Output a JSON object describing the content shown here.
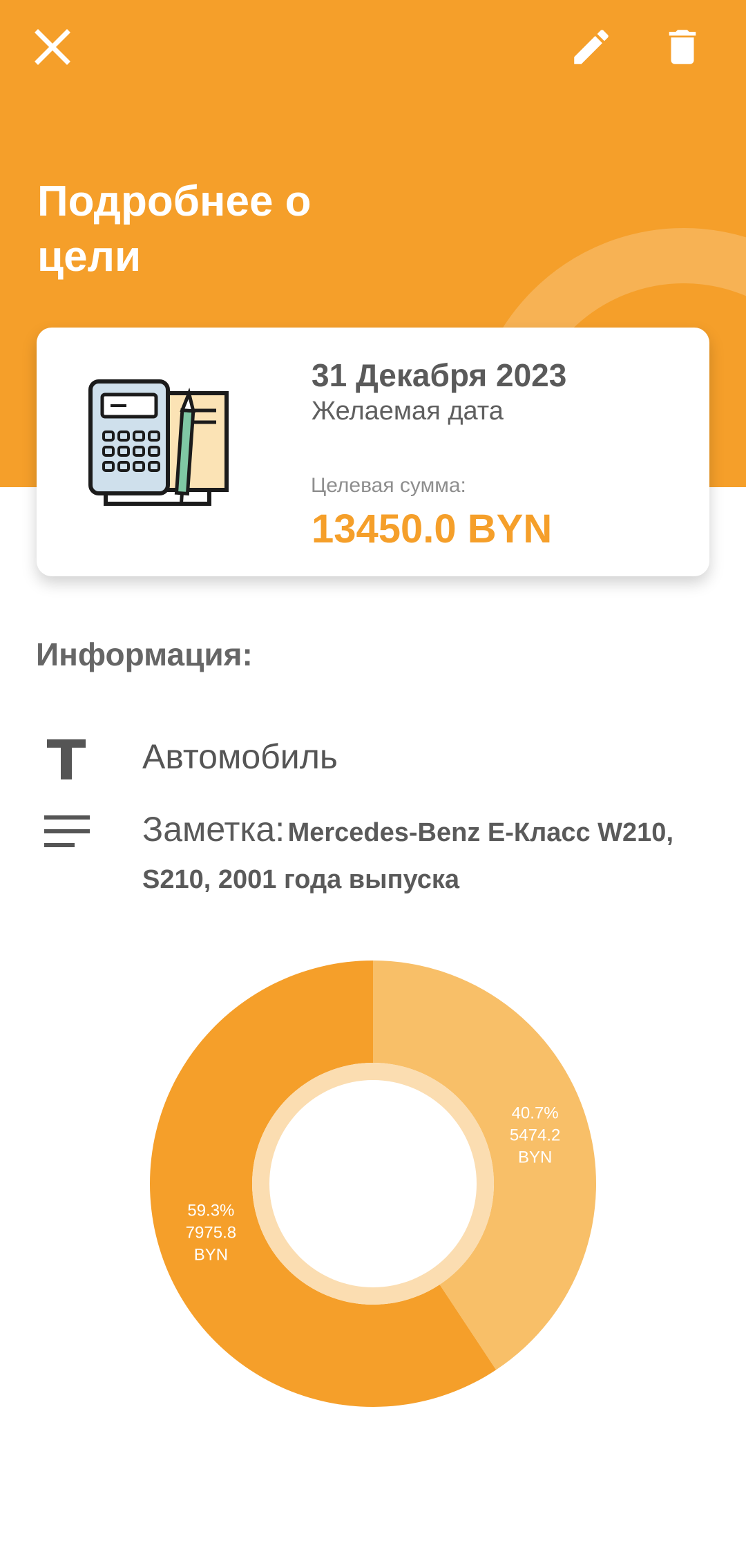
{
  "header": {
    "title": "Подробнее о цели",
    "close_icon": "close-icon",
    "edit_icon": "pencil-icon",
    "delete_icon": "trash-icon",
    "color": "#F59F2A"
  },
  "card": {
    "illustration": "calculator-document-icon",
    "date": "31 Декабря 2023",
    "date_caption": "Желаемая дата",
    "amount_label": "Целевая сумма:",
    "amount_value": "13450.0 BYN"
  },
  "info": {
    "title": "Информация:",
    "name_icon": "text-title-icon",
    "name": "Автомобиль",
    "note_icon": "notes-lines-icon",
    "note_label": "Заметка:",
    "note_text": "Mercedes-Benz E-Класс W210, S210, 2001 года выпуска"
  },
  "chart_data": {
    "type": "pie",
    "style": "donut",
    "slices": [
      {
        "percent": 40.7,
        "value": 5474.2,
        "label": "40.7%",
        "amount": "5474.2",
        "unit": "BYN",
        "color": "#F8BF68"
      },
      {
        "percent": 59.3,
        "value": 7975.8,
        "label": "59.3%",
        "amount": "7975.8",
        "unit": "BYN",
        "color": "#F59F2A"
      }
    ],
    "start": "top",
    "direction": "clockwise",
    "inner_ring_color": "#FBDDB1"
  }
}
